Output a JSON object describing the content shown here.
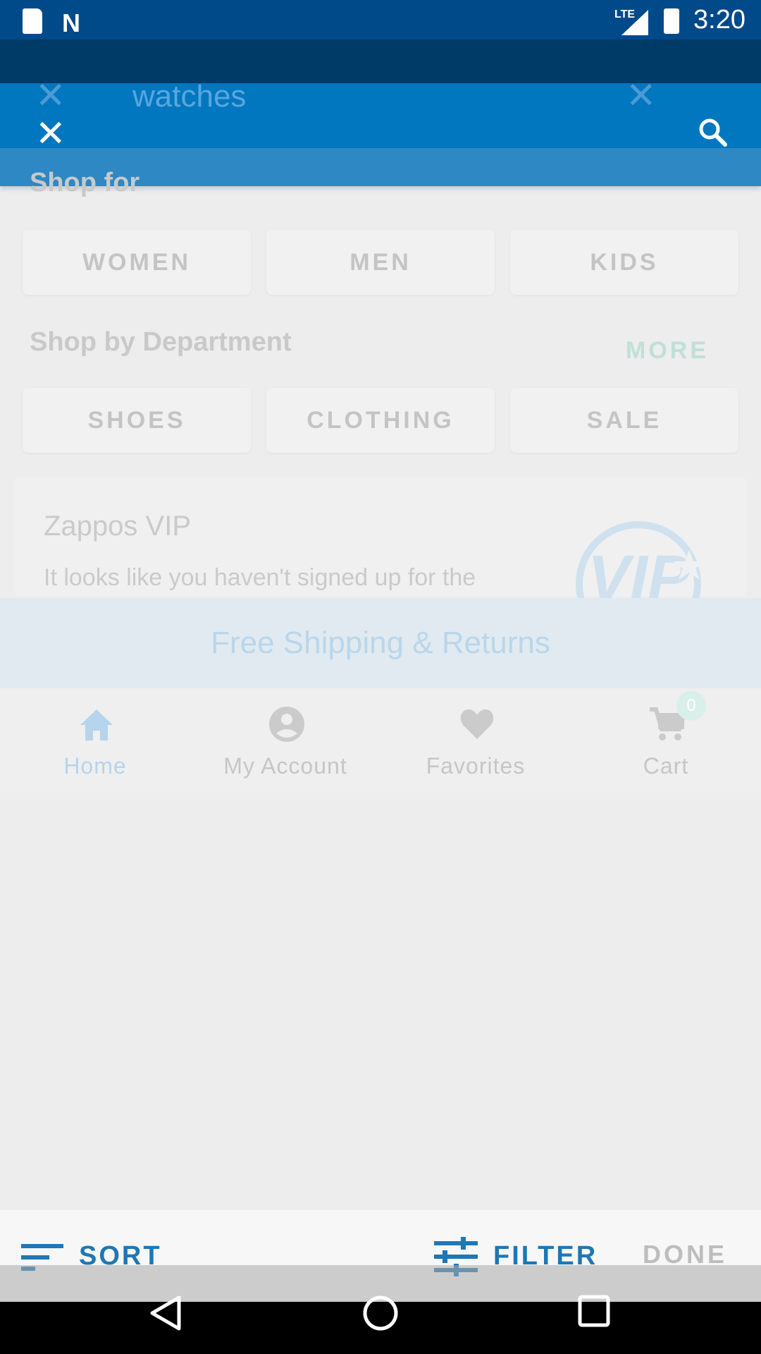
{
  "status_bar": {
    "time": "3:20",
    "network": "LTE"
  },
  "search": {
    "query": "watches"
  },
  "shop_for": {
    "title": "Shop for",
    "chips": [
      "WOMEN",
      "MEN",
      "KIDS"
    ]
  },
  "departments": {
    "title": "Shop by Department",
    "more_label": "MORE",
    "chips": [
      "SHOES",
      "CLOTHING",
      "SALE"
    ]
  },
  "vip": {
    "title": "Zappos VIP",
    "body": "It looks like you haven't signed up for the",
    "logo_text": "VIP"
  },
  "banner": {
    "text": "Free Shipping & Returns"
  },
  "bottom_nav": {
    "items": [
      {
        "label": "Home",
        "icon": "home-icon"
      },
      {
        "label": "My Account",
        "icon": "account-icon"
      },
      {
        "label": "Favorites",
        "icon": "heart-icon"
      },
      {
        "label": "Cart",
        "icon": "cart-icon"
      }
    ],
    "cart_count": "0"
  },
  "action_bar": {
    "sort_label": "SORT",
    "filter_label": "FILTER",
    "done_label": "DONE"
  },
  "colors": {
    "toolbar": "#0077bf",
    "status_bar": "#004a8a",
    "accent": "#1f77b4"
  }
}
